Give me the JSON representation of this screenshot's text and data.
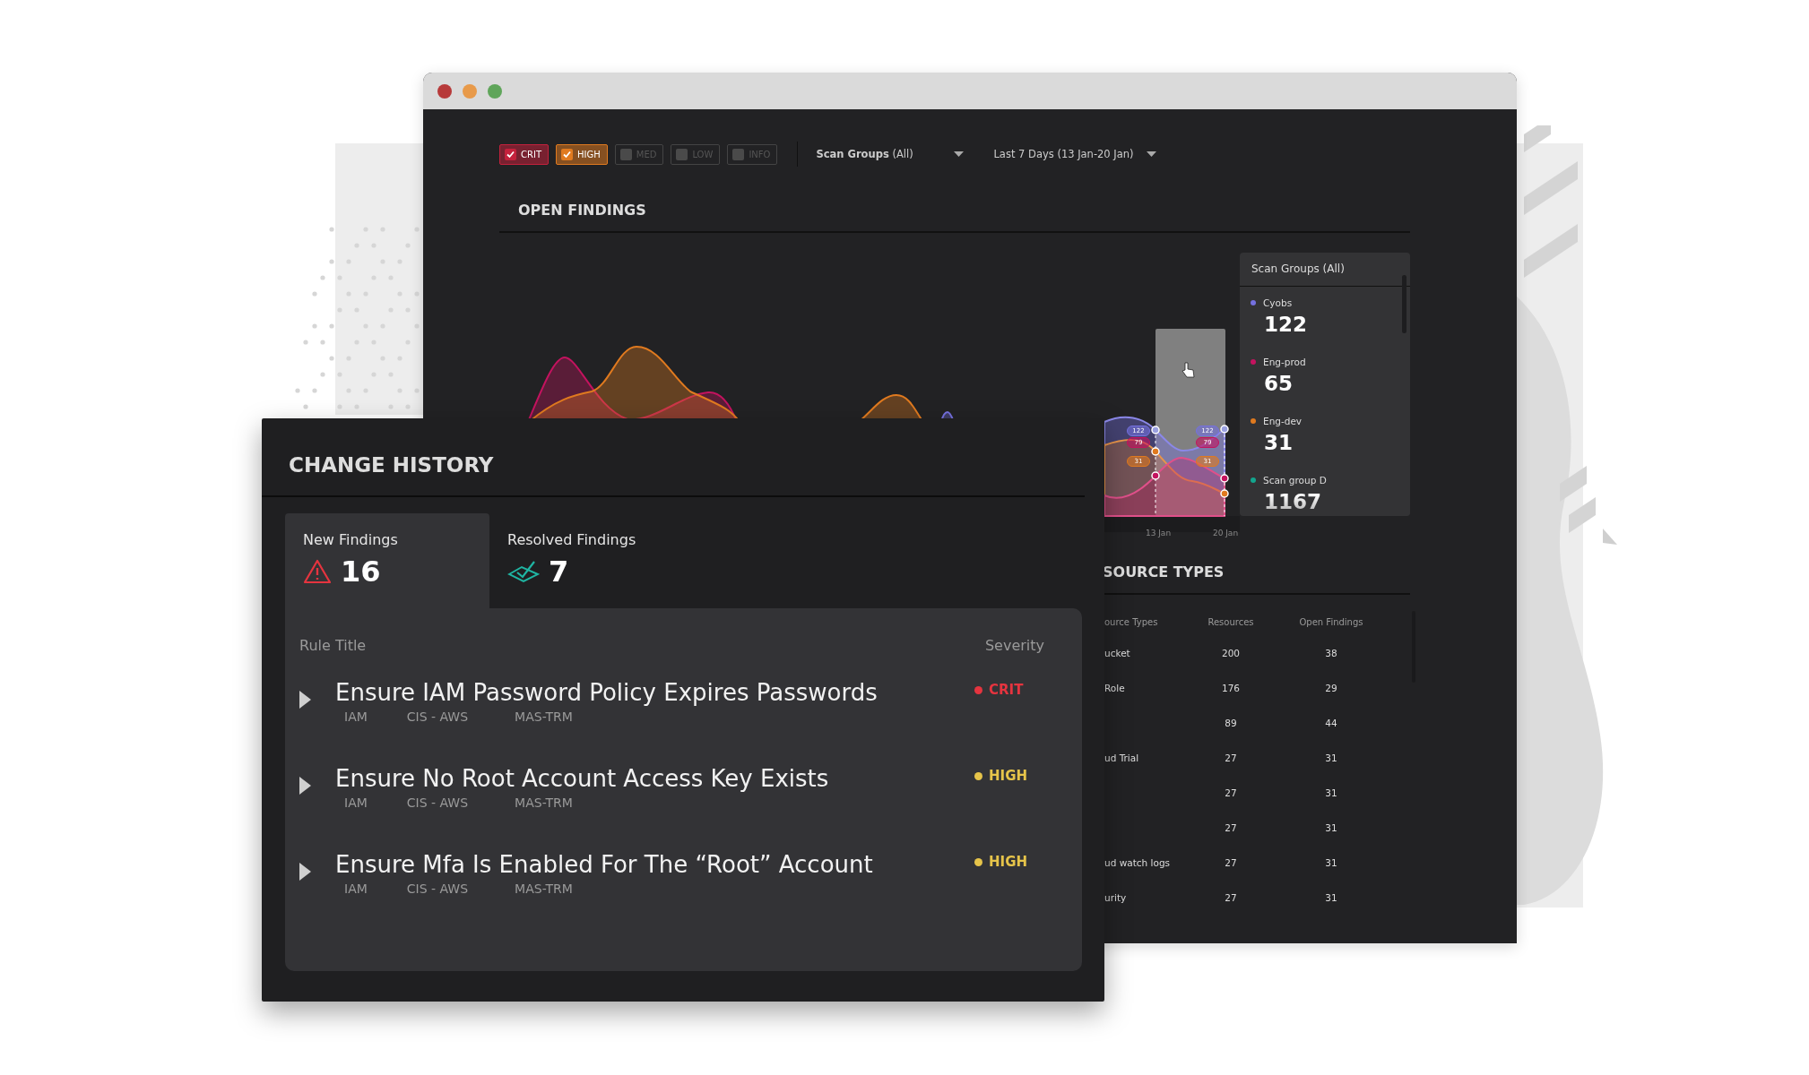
{
  "filters": [
    {
      "label": "CRIT",
      "checked": true,
      "color": "#c4213c"
    },
    {
      "label": "HIGH",
      "checked": true,
      "color": "#e07a1f"
    },
    {
      "label": "MED",
      "checked": false
    },
    {
      "label": "LOW",
      "checked": false
    },
    {
      "label": "INFO",
      "checked": false
    }
  ],
  "dropdowns": [
    {
      "label": "**Scan Groups** (All)"
    },
    {
      "label": "Last 7 Days (13 Jan-20 Jan)"
    }
  ],
  "open_findings": {
    "title": "OPEN FINDINGS",
    "chart": {
      "markers": [
        {
          "date": "13 Jan",
          "labels": [
            {
              "text": "122",
              "color": "#7571e0"
            },
            {
              "text": "79",
              "color": "#c4135f"
            },
            {
              "text": "31",
              "color": "#e07a1f"
            }
          ]
        },
        {
          "date": "20 Jan",
          "labels": [
            {
              "text": "122",
              "color": "#7571e0"
            },
            {
              "text": "79",
              "color": "#c4135f"
            },
            {
              "text": "31",
              "color": "#e07a1f"
            }
          ]
        }
      ]
    },
    "legend": {
      "title": "Scan Groups (All)",
      "items": [
        {
          "name": "Cyobs",
          "value": "122",
          "color": "#7571e0"
        },
        {
          "name": "Eng-prod",
          "value": "65",
          "color": "#c4135f"
        },
        {
          "name": "Eng-dev",
          "value": "31",
          "color": "#e07a1f"
        },
        {
          "name": "Scan group D",
          "value": "1167",
          "color": "#13a58e"
        }
      ]
    }
  },
  "resource_types": {
    "title": "SOURCE TYPES",
    "columns": [
      "ource Types",
      "Resources",
      "Open Findings"
    ],
    "rows": [
      {
        "name": "ucket",
        "resources": "200",
        "open_findings": "38"
      },
      {
        "name": "Role",
        "resources": "176",
        "open_findings": "29"
      },
      {
        "resources": "89",
        "open_findings": "44"
      },
      {
        "name": "ud Trial",
        "resources": "27",
        "open_findings": "31"
      },
      {
        "resources": "27",
        "open_findings": "31"
      },
      {
        "resources": "27",
        "open_findings": "31"
      },
      {
        "name": "ud watch logs",
        "resources": "27",
        "open_findings": "31"
      },
      {
        "name": "urity",
        "resources": "27",
        "open_findings": "31"
      }
    ]
  },
  "change_history": {
    "title": "CHANGE HISTORY",
    "tabs": [
      {
        "label": "New Findings",
        "count": "16",
        "kind": "new",
        "selected": true
      },
      {
        "label": "Resolved Findings",
        "count": "7",
        "kind": "resolved",
        "selected": false
      }
    ],
    "columns": [
      "Rule Title",
      "Severity"
    ],
    "rules": [
      {
        "title": "Ensure IAM Password Policy Expires Passwords",
        "tags": [
          "IAM",
          "CIS - AWS",
          "MAS-TRM"
        ],
        "severity": "CRIT",
        "kind": "crit"
      },
      {
        "title": "Ensure No Root Account Access Key Exists",
        "tags": [
          "IAM",
          "CIS - AWS",
          "MAS-TRM"
        ],
        "severity": "HIGH",
        "kind": "high"
      },
      {
        "title": "Ensure Mfa Is Enabled For The “Root” Account",
        "tags": [
          "IAM",
          "CIS - AWS",
          "MAS-TRM"
        ],
        "severity": "HIGH",
        "kind": "high"
      }
    ]
  }
}
